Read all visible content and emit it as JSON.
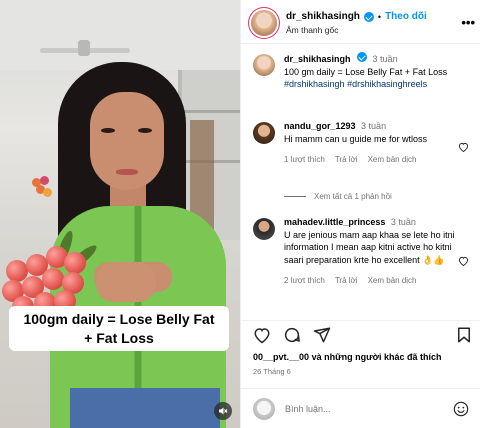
{
  "video": {
    "caption_line1": "100gm daily = Lose Belly Fat",
    "caption_line2": "+ Fat Loss",
    "mute_icon": "speaker-muted-icon"
  },
  "header": {
    "username": "dr_shikhasingh",
    "follow_label": "Theo dõi",
    "separator": "•",
    "audio_label": "Âm thanh gốc",
    "more_icon": "•••"
  },
  "post_caption": {
    "username": "dr_shikhasingh",
    "time": "3 tuần",
    "text": "100 gm daily = Lose Belly Fat + Fat Loss",
    "hashtag1": "#drshikhasingh",
    "hashtag2": "#drshikhasinghreels"
  },
  "comments": [
    {
      "username": "nandu_gor_1293",
      "time": "3 tuần",
      "text": "Hi mamm can u guide me for wtloss",
      "likes": "1 lượt thích",
      "reply": "Trả lời",
      "translate": "Xem bản dịch",
      "view_replies": "Xem tất cả 1 phản hồi"
    },
    {
      "username": "mahadev.little_princess",
      "time": "3 tuần",
      "text": "U are jenious mam aap khaa se lete ho itni information I mean aap kitni active ho kitni saari preparation krte ho excellent 👌👍",
      "likes": "2 lượt thích",
      "reply": "Trả lời",
      "translate": "Xem bản dịch"
    }
  ],
  "likes_summary": {
    "user": "00__pvt.__00",
    "rest": "và những người khác đã thích"
  },
  "date": "26 Tháng 6",
  "add_comment": {
    "placeholder": "Bình luận..."
  },
  "colors": {
    "link_blue": "#0095f6",
    "hashtag": "#00376b",
    "muted_text": "#737373",
    "shirt_green": "#7cc653"
  }
}
